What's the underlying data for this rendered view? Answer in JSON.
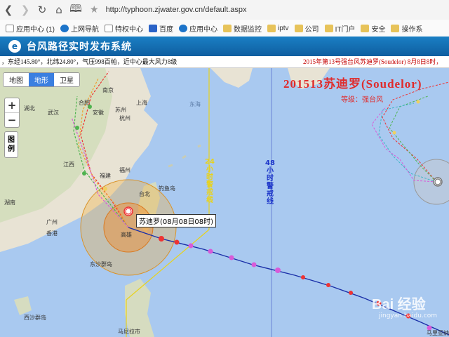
{
  "browser": {
    "url": "http://typhoon.zjwater.gov.cn/default.aspx",
    "bookmarks": [
      {
        "label": "应用中心 (1)",
        "icon": "page-icon"
      },
      {
        "label": "上网导航",
        "icon": "ie-icon"
      },
      {
        "label": "特权中心",
        "icon": "page-icon"
      },
      {
        "label": "百度",
        "icon": "baidu-paw-icon"
      },
      {
        "label": "应用中心",
        "icon": "app-icon"
      },
      {
        "label": "数据监控",
        "icon": "folder-icon"
      },
      {
        "label": "iptv",
        "icon": "folder-icon"
      },
      {
        "label": "公司",
        "icon": "folder-icon"
      },
      {
        "label": "IT门户",
        "icon": "folder-icon"
      },
      {
        "label": "安全",
        "icon": "folder-icon"
      },
      {
        "label": "操作系",
        "icon": "folder-icon"
      }
    ]
  },
  "app": {
    "title": "台风路径实时发布系统",
    "ticker_left": "，东经145.80°，北纬24.80°，气压998百帕，近中心最大风力8级",
    "ticker_right": "2015年第13号强台风苏迪罗(Soudelor)  8月8日8时，"
  },
  "map": {
    "map_types": [
      "地图",
      "地形",
      "卫星"
    ],
    "active_map_type": "地形",
    "zoom_in": "+",
    "zoom_out": "−",
    "legend_label": "图例",
    "storm_title": "201513苏迪罗(Soudelor)",
    "storm_grade": "等级：强台风",
    "line24_label": "24小时警戒线",
    "line48_label": "48小时警戒线",
    "storm_tag": "苏迪罗(08月08日08时)",
    "places": [
      "南京",
      "苏州",
      "上海",
      "合肥",
      "杭州",
      "武汉",
      "安徽",
      "湖北",
      "江西",
      "福建",
      "福州",
      "台北",
      "广州",
      "香港",
      "东沙群岛",
      "西沙群岛",
      "马尼拉市",
      "高雄",
      "湖南",
      "东海",
      "马里亚纳",
      "钓鱼岛"
    ],
    "watermark": "Bai 经验",
    "watermark_sub": "jingyan.baidu.com"
  }
}
